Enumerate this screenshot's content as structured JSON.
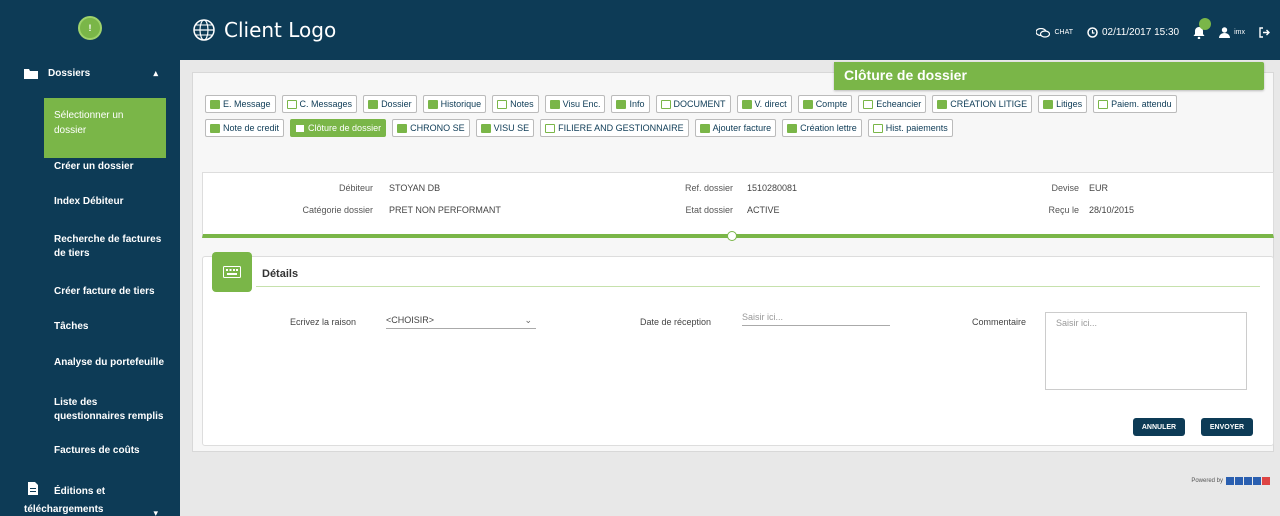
{
  "header": {
    "logo_text": "Client Logo",
    "chat_label": "CHAT",
    "datetime": "02/11/2017 15:30",
    "notifications_count": "",
    "user": "imx"
  },
  "sidebar": {
    "avatar": "!",
    "root_label": "Dossiers",
    "active_item": "Sélectionner un dossier",
    "items": [
      "Créer un dossier",
      "Index Débiteur",
      "Recherche de factures de tiers",
      "Créer facture de tiers",
      "Tâches",
      "Analyse du portefeuille",
      "Liste des questionnaires remplis",
      "Factures de coûts"
    ],
    "editions_label_1": "Éditions et",
    "editions_label_2": "téléchargements"
  },
  "toolbar": {
    "row1": [
      "E. Message",
      "C. Messages",
      "Dossier",
      "Historique",
      "Notes",
      "Visu Enc.",
      "Info",
      "DOCUMENT",
      "V. direct",
      "Compte",
      "Echeancier",
      "CRÉATION LITIGE",
      "Litiges",
      "Paiem. attendu"
    ],
    "row2": [
      "Note de credit",
      "Clôture de dossier",
      "CHRONO SE",
      "VISU SE",
      "FILIERE AND GESTIONNAIRE",
      "Ajouter facture",
      "Création lettre",
      "Hist. paiements"
    ],
    "active": "Clôture de dossier"
  },
  "popup_title": "Clôture de dossier",
  "info": {
    "debiteur_label": "Débiteur",
    "debiteur_value": "STOYAN DB",
    "categorie_label": "Catégorie dossier",
    "categorie_value": "PRET NON PERFORMANT",
    "ref_label": "Ref. dossier",
    "ref_value": "1510280081",
    "etat_label": "Etat dossier",
    "etat_value": "ACTIVE",
    "devise_label": "Devise",
    "devise_value": "EUR",
    "recu_label": "Reçu le",
    "recu_value": "28/10/2015"
  },
  "details": {
    "title": "Détails",
    "raison_label": "Ecrivez la raison",
    "raison_value": "<CHOISIR>",
    "date_label": "Date de réception",
    "date_placeholder": "Saisir ici...",
    "commentaire_label": "Commentaire",
    "commentaire_placeholder": "Saisir ici...",
    "cancel_label": "ANNULER",
    "send_label": "ENVOYER"
  },
  "footer": {
    "powered_by": "Powered by"
  },
  "colors": {
    "navy": "#0d3b56",
    "green": "#7ab648"
  }
}
